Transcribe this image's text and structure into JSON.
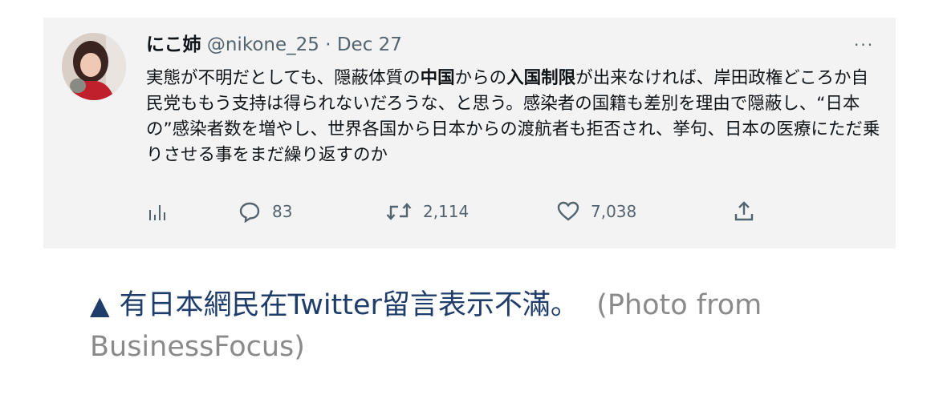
{
  "tweet": {
    "author_name": "にこ姉",
    "handle": "@nikone_25",
    "separator": "·",
    "date": "Dec 27",
    "more_label": "···",
    "body": [
      {
        "text": "実態が不明だとしても、隠蔽体質の",
        "bold": false
      },
      {
        "text": "中国",
        "bold": true
      },
      {
        "text": "からの",
        "bold": false
      },
      {
        "text": "入国制限",
        "bold": true
      },
      {
        "text": "が出来なければ、岸田政権どころか自民党ももう支持は得られないだろうな、と思う。感染者の国籍も差別を理由で隠蔽し、“日本の”感染者数を増やし、世界各国から日本からの渡航者も拒否され、挙句、日本の医療にただ乗りさせる事をまだ繰り返すのか",
        "bold": false
      }
    ],
    "actions": {
      "analytics_icon": "bar-chart-icon",
      "replies": "83",
      "retweets": "2,114",
      "likes": "7,038",
      "share_icon": "share-icon"
    }
  },
  "caption": {
    "marker": "▲",
    "text": "有日本網民在Twitter留言表示不滿。",
    "credit": "(Photo from BusinessFocus)"
  },
  "colors": {
    "card_bg": "#f3f3f3",
    "caption_text": "#1e3d6b",
    "muted": "#53646f"
  }
}
